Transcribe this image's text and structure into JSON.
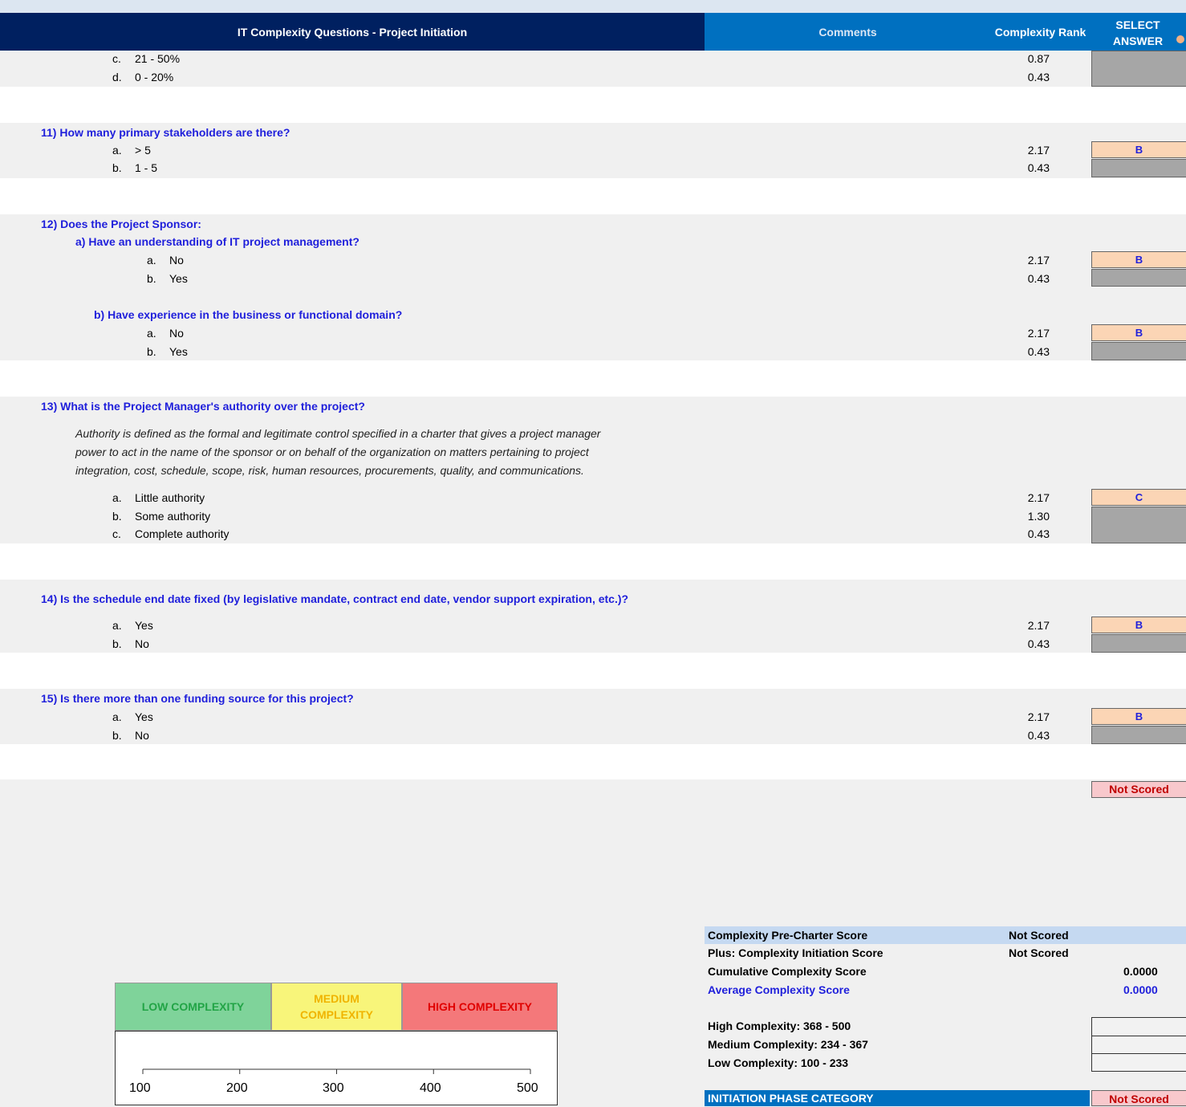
{
  "header": {
    "questions_title": "IT Complexity Questions - Project Initiation",
    "comments_title": "Comments",
    "rank_title": "Complexity Rank",
    "select_title_1": "SELECT",
    "select_title_2": "ANSWER"
  },
  "q10_tail": {
    "options": [
      {
        "letter": "c.",
        "text": "21 - 50%",
        "rank": "0.87"
      },
      {
        "letter": "d.",
        "text": "0 - 20%",
        "rank": "0.43"
      }
    ]
  },
  "q11": {
    "question": "11)  How many primary stakeholders are there?",
    "options": [
      {
        "letter": "a.",
        "text": "> 5",
        "rank": "2.17"
      },
      {
        "letter": "b.",
        "text": "1 - 5",
        "rank": "0.43"
      }
    ],
    "answer": "B"
  },
  "q12": {
    "question": "12)  Does the Project Sponsor:",
    "sub_a": "a)  Have an understanding of IT project management?",
    "sub_a_options": [
      {
        "letter": "a.",
        "text": "No",
        "rank": "2.17"
      },
      {
        "letter": "b.",
        "text": "Yes",
        "rank": "0.43"
      }
    ],
    "sub_a_answer": "B",
    "sub_b": "b)  Have experience in the business or functional domain?",
    "sub_b_options": [
      {
        "letter": "a.",
        "text": "No",
        "rank": "2.17"
      },
      {
        "letter": "b.",
        "text": "Yes",
        "rank": "0.43"
      }
    ],
    "sub_b_answer": "B"
  },
  "q13": {
    "question": "13)  What is the Project Manager's authority over the project?",
    "desc_1": "Authority is defined as the formal and legitimate control specified in a charter that gives a project manager",
    "desc_2": "power to act in the name of the sponsor or on behalf of the organization on matters pertaining to project",
    "desc_3": "integration, cost, schedule, scope, risk, human resources, procurements, quality, and communications.",
    "options": [
      {
        "letter": "a.",
        "text": "Little authority",
        "rank": "2.17"
      },
      {
        "letter": "b.",
        "text": "Some authority",
        "rank": "1.30"
      },
      {
        "letter": "c.",
        "text": "Complete authority",
        "rank": "0.43"
      }
    ],
    "answer": "C"
  },
  "q14": {
    "question": "14)  Is the schedule end date fixed (by legislative mandate, contract end date, vendor support expiration, etc.)?",
    "options": [
      {
        "letter": "a.",
        "text": "Yes",
        "rank": "2.17"
      },
      {
        "letter": "b.",
        "text": "No",
        "rank": "0.43"
      }
    ],
    "answer": "B"
  },
  "q15": {
    "question": "15)  Is there more than one funding source for this project?",
    "options": [
      {
        "letter": "a.",
        "text": "Yes",
        "rank": "2.17"
      },
      {
        "letter": "b.",
        "text": "No",
        "rank": "0.43"
      }
    ],
    "answer": "B"
  },
  "section_score": "Not Scored",
  "summary": {
    "pre_charter_label": "Complexity Pre-Charter Score",
    "pre_charter_value": "Not Scored",
    "initiation_label": "Plus: Complexity Initiation Score",
    "initiation_value": "Not Scored",
    "cumulative_label": "Cumulative Complexity Score",
    "cumulative_value": "0.0000",
    "average_label": "Average Complexity Score",
    "average_value": "0.0000",
    "high_label": "High Complexity:  368 - 500",
    "medium_label": "Medium Complexity:  234 - 367",
    "low_label": "Low Complexity:  100 - 233",
    "category_label": "INITIATION PHASE CATEGORY",
    "category_value": "Not Scored"
  },
  "legend": {
    "low": "LOW COMPLEXITY",
    "medium_1": "MEDIUM",
    "medium_2": "COMPLEXITY",
    "high": "HIGH COMPLEXITY",
    "colors": {
      "low": "#7fd39a",
      "medium": "#f8f57a",
      "high": "#f4787a"
    },
    "axis_ticks": [
      "100",
      "200",
      "300",
      "400",
      "500"
    ]
  }
}
